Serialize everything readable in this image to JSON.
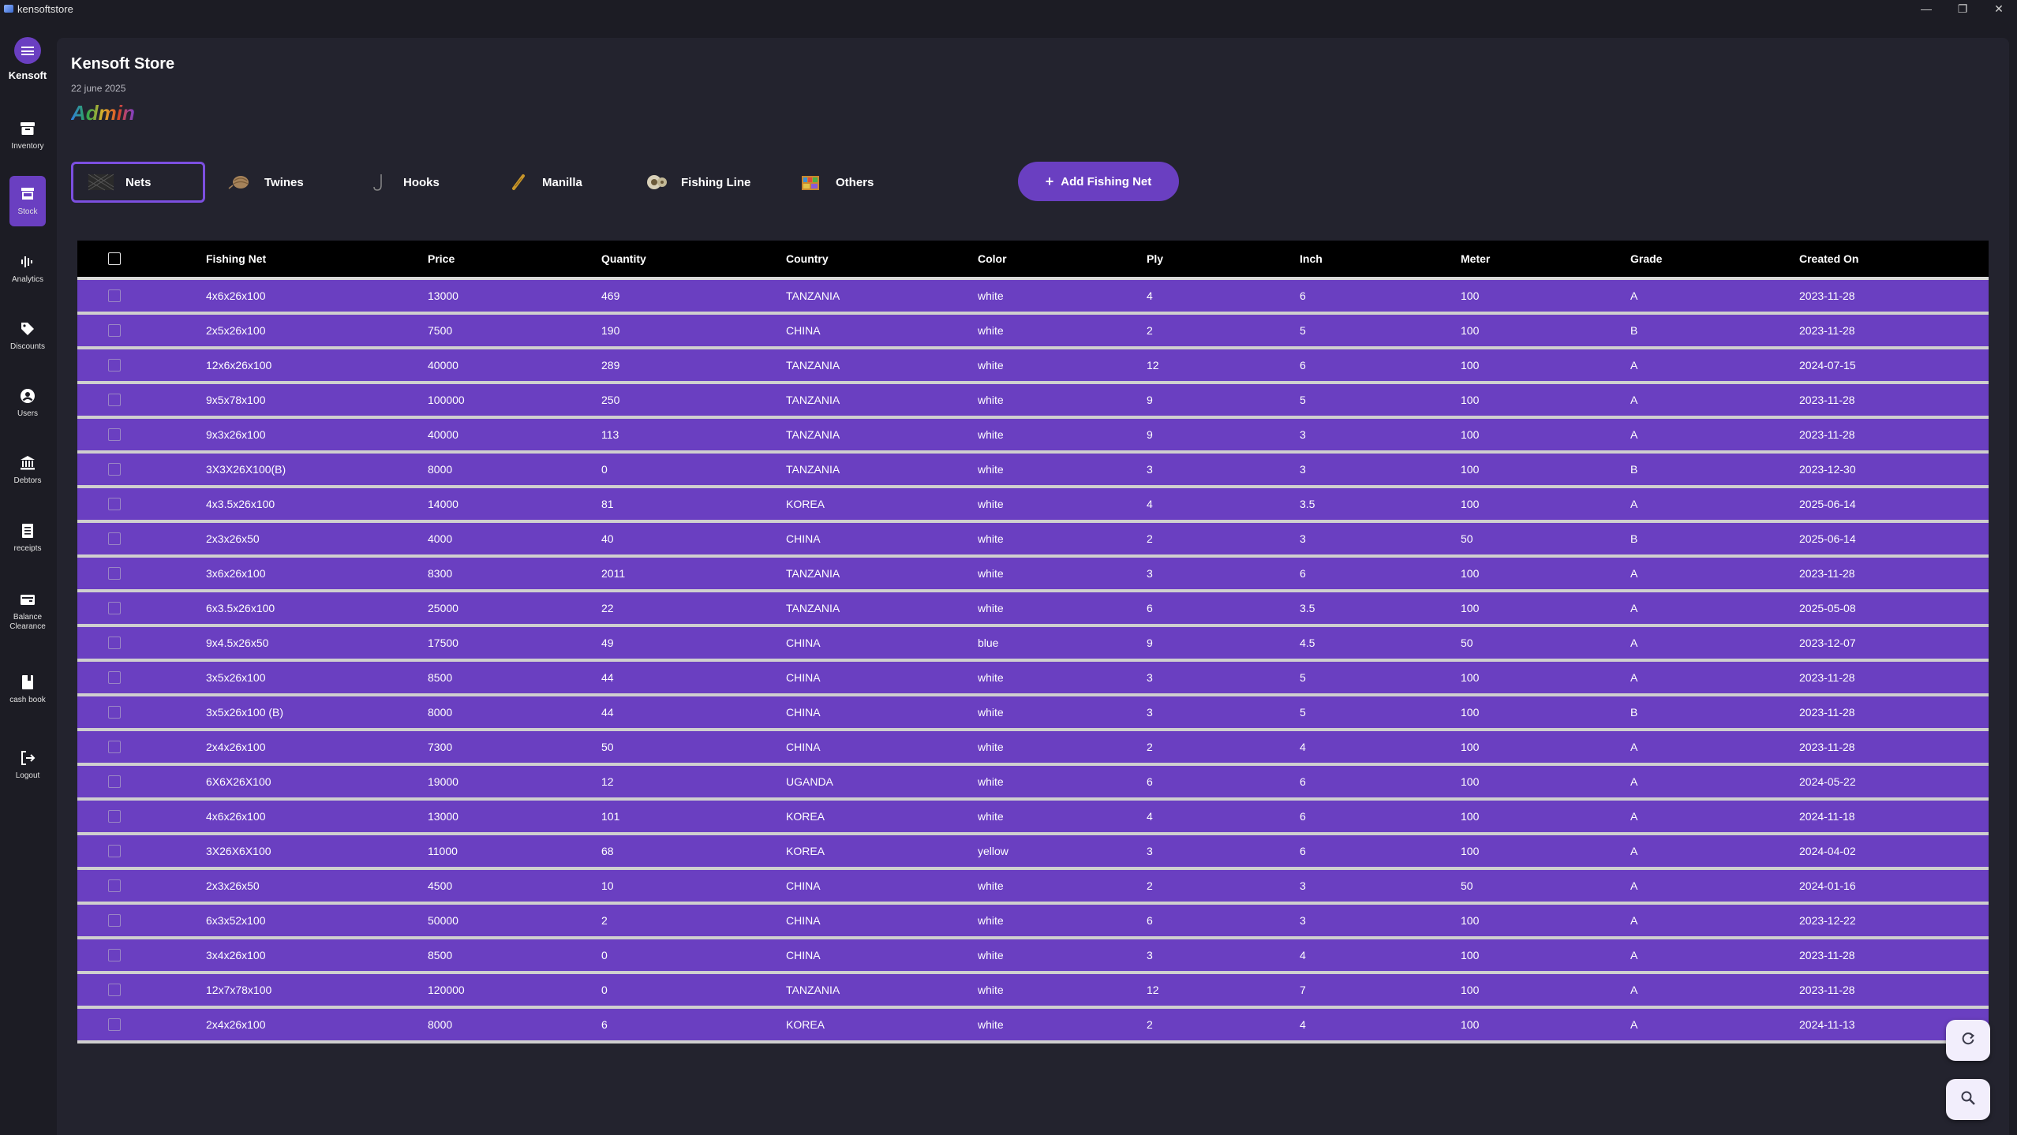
{
  "window": {
    "title": "kensoftstore",
    "controls": {
      "minimize": "—",
      "restore": "❐",
      "close": "✕"
    }
  },
  "sidebar": {
    "brand_name": "Kensoft",
    "items": [
      {
        "label": "Inventory",
        "icon": "archive-icon"
      },
      {
        "label": "Stock",
        "icon": "store-icon",
        "active": true
      },
      {
        "label": "Analytics",
        "icon": "waveform-icon"
      },
      {
        "label": "Discounts",
        "icon": "tag-icon"
      },
      {
        "label": "Users",
        "icon": "user-circle-icon"
      },
      {
        "label": "Debtors",
        "icon": "bank-icon"
      },
      {
        "label": "receipts",
        "icon": "receipt-icon"
      },
      {
        "label": "Balance Clearance",
        "icon": "wallet-icon"
      },
      {
        "label": "cash book",
        "icon": "book-icon"
      },
      {
        "label": "Logout",
        "icon": "logout-icon"
      }
    ]
  },
  "header": {
    "store_title": "Kensoft Store",
    "date": "22 june 2025",
    "role": "Admin"
  },
  "tabs": [
    {
      "label": "Nets",
      "icon": "net-icon",
      "active": true
    },
    {
      "label": "Twines",
      "icon": "twine-icon"
    },
    {
      "label": "Hooks",
      "icon": "hook-icon"
    },
    {
      "label": "Manilla",
      "icon": "manilla-rope-icon"
    },
    {
      "label": "Fishing Line",
      "icon": "fishing-line-spool-icon"
    },
    {
      "label": "Others",
      "icon": "others-box-icon"
    }
  ],
  "add_button": {
    "label": "Add Fishing Net",
    "icon": "plus-icon"
  },
  "table": {
    "columns": [
      "Fishing Net",
      "Price",
      "Quantity",
      "Country",
      "Color",
      "Ply",
      "Inch",
      "Meter",
      "Grade",
      "Created On"
    ],
    "rows": [
      [
        "4x6x26x100",
        "13000",
        "469",
        "TANZANIA",
        "white",
        "4",
        "6",
        "100",
        "A",
        "2023-11-28"
      ],
      [
        "2x5x26x100",
        "7500",
        "190",
        "CHINA",
        "white",
        "2",
        "5",
        "100",
        "B",
        "2023-11-28"
      ],
      [
        "12x6x26x100",
        "40000",
        "289",
        "TANZANIA",
        "white",
        "12",
        "6",
        "100",
        "A",
        "2024-07-15"
      ],
      [
        "9x5x78x100",
        "100000",
        "250",
        "TANZANIA",
        "white",
        "9",
        "5",
        "100",
        "A",
        "2023-11-28"
      ],
      [
        "9x3x26x100",
        "40000",
        "113",
        "TANZANIA",
        "white",
        "9",
        "3",
        "100",
        "A",
        "2023-11-28"
      ],
      [
        "3X3X26X100(B)",
        "8000",
        "0",
        "TANZANIA",
        "white",
        "3",
        "3",
        "100",
        "B",
        "2023-12-30"
      ],
      [
        "4x3.5x26x100",
        "14000",
        "81",
        "KOREA",
        "white",
        "4",
        "3.5",
        "100",
        "A",
        "2025-06-14"
      ],
      [
        "2x3x26x50",
        "4000",
        "40",
        "CHINA",
        "white",
        "2",
        "3",
        "50",
        "B",
        "2025-06-14"
      ],
      [
        "3x6x26x100",
        "8300",
        "2011",
        "TANZANIA",
        "white",
        "3",
        "6",
        "100",
        "A",
        "2023-11-28"
      ],
      [
        "6x3.5x26x100",
        "25000",
        "22",
        "TANZANIA",
        "white",
        "6",
        "3.5",
        "100",
        "A",
        "2025-05-08"
      ],
      [
        "9x4.5x26x50",
        "17500",
        "49",
        "CHINA",
        "blue",
        "9",
        "4.5",
        "50",
        "A",
        "2023-12-07"
      ],
      [
        "3x5x26x100",
        "8500",
        "44",
        "CHINA",
        "white",
        "3",
        "5",
        "100",
        "A",
        "2023-11-28"
      ],
      [
        "3x5x26x100 (B)",
        "8000",
        "44",
        "CHINA",
        "white",
        "3",
        "5",
        "100",
        "B",
        "2023-11-28"
      ],
      [
        "2x4x26x100",
        "7300",
        "50",
        "CHINA",
        "white",
        "2",
        "4",
        "100",
        "A",
        "2023-11-28"
      ],
      [
        "6X6X26X100",
        "19000",
        "12",
        "UGANDA",
        "white",
        "6",
        "6",
        "100",
        "A",
        "2024-05-22"
      ],
      [
        "4x6x26x100",
        "13000",
        "101",
        "KOREA",
        "white",
        "4",
        "6",
        "100",
        "A",
        "2024-11-18"
      ],
      [
        "3X26X6X100",
        "11000",
        "68",
        "KOREA",
        "yellow",
        "3",
        "6",
        "100",
        "A",
        "2024-04-02"
      ],
      [
        "2x3x26x50",
        "4500",
        "10",
        "CHINA",
        "white",
        "2",
        "3",
        "50",
        "A",
        "2024-01-16"
      ],
      [
        "6x3x52x100",
        "50000",
        "2",
        "CHINA",
        "white",
        "6",
        "3",
        "100",
        "A",
        "2023-12-22"
      ],
      [
        "3x4x26x100",
        "8500",
        "0",
        "CHINA",
        "white",
        "3",
        "4",
        "100",
        "A",
        "2023-11-28"
      ],
      [
        "12x7x78x100",
        "120000",
        "0",
        "TANZANIA",
        "white",
        "12",
        "7",
        "100",
        "A",
        "2023-11-28"
      ],
      [
        "2x4x26x100",
        "8000",
        "6",
        "KOREA",
        "white",
        "2",
        "4",
        "100",
        "A",
        "2024-11-13"
      ]
    ]
  },
  "floating_buttons": [
    {
      "name": "refresh",
      "icon": "refresh-icon"
    },
    {
      "name": "search",
      "icon": "search-icon"
    }
  ],
  "colors": {
    "accent": "#6a3fc1",
    "background": "#1c1c24",
    "panel": "#23232e",
    "row_separator": "#cfcfcf"
  }
}
